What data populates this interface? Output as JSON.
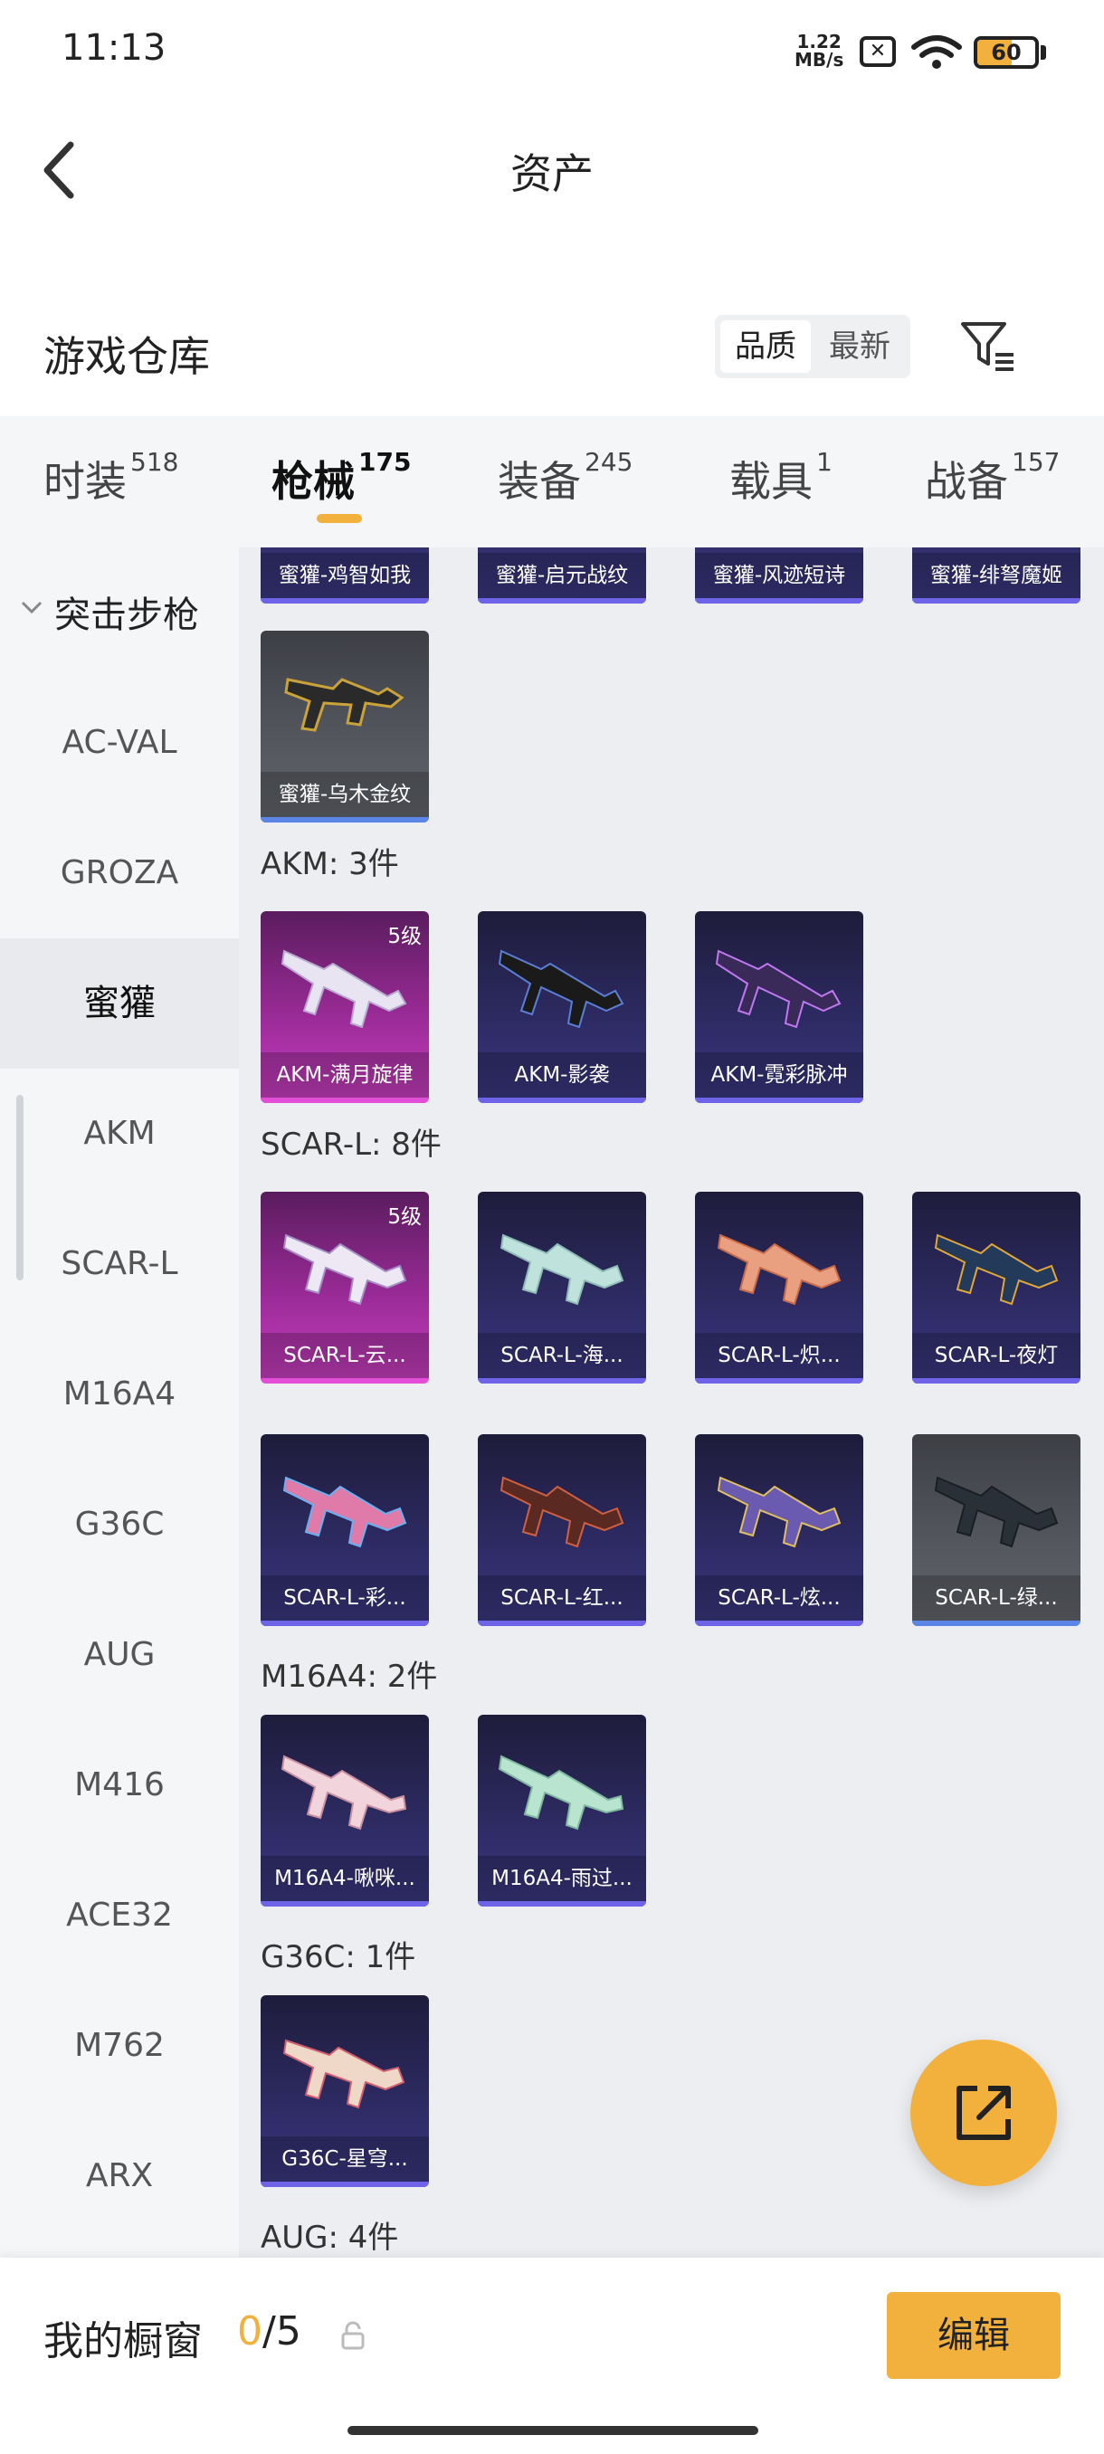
{
  "status": {
    "time": "11:13",
    "speed_value": "1.22",
    "speed_unit": "MB/s",
    "battery": "60"
  },
  "header": {
    "title": "资产"
  },
  "warehouse": {
    "label": "游戏仓库",
    "sort_quality": "品质",
    "sort_latest": "最新"
  },
  "tabs": [
    {
      "label": "时装",
      "count": "518"
    },
    {
      "label": "枪械",
      "count": "175"
    },
    {
      "label": "装备",
      "count": "245"
    },
    {
      "label": "载具",
      "count": "1"
    },
    {
      "label": "战备",
      "count": "157"
    }
  ],
  "sidebar": {
    "category": "突击步枪",
    "items": [
      "AC-VAL",
      "GROZA",
      "蜜獾",
      "AKM",
      "SCAR-L",
      "M16A4",
      "G36C",
      "AUG",
      "M416",
      "ACE32",
      "M762",
      "ARX"
    ]
  },
  "content": {
    "top_partial": [
      "蜜獾-鸡智如我",
      "蜜獾-启元战纹",
      "蜜獾-风迹短诗",
      "蜜獾-绯弩魔姬"
    ],
    "honeybadger_card": {
      "name": "蜜獾-乌木金纹"
    },
    "sections": [
      {
        "title": "AKM: 3件",
        "items": [
          {
            "name": "AKM-满月旋律",
            "level": "5级"
          },
          {
            "name": "AKM-影袭"
          },
          {
            "name": "AKM-霓彩脉冲"
          }
        ]
      },
      {
        "title": "SCAR-L: 8件",
        "items": [
          {
            "name": "SCAR-L-云...",
            "level": "5级"
          },
          {
            "name": "SCAR-L-海..."
          },
          {
            "name": "SCAR-L-炽..."
          },
          {
            "name": "SCAR-L-夜灯"
          },
          {
            "name": "SCAR-L-彩..."
          },
          {
            "name": "SCAR-L-红..."
          },
          {
            "name": "SCAR-L-炫..."
          },
          {
            "name": "SCAR-L-绿..."
          }
        ]
      },
      {
        "title": "M16A4: 2件",
        "items": [
          {
            "name": "M16A4-啾咪..."
          },
          {
            "name": "M16A4-雨过..."
          }
        ]
      },
      {
        "title": "G36C: 1件",
        "items": [
          {
            "name": "G36C-星穹..."
          }
        ]
      },
      {
        "title": "AUG: 4件"
      }
    ]
  },
  "bottom": {
    "label": "我的橱窗",
    "count_current": "0",
    "count_total": "/5",
    "edit": "编辑"
  },
  "colors": {
    "accent": "#f2b03c",
    "purple_card": "#2d2a62",
    "pink_card": "#9a2b97",
    "grey_card": "#55585f"
  }
}
